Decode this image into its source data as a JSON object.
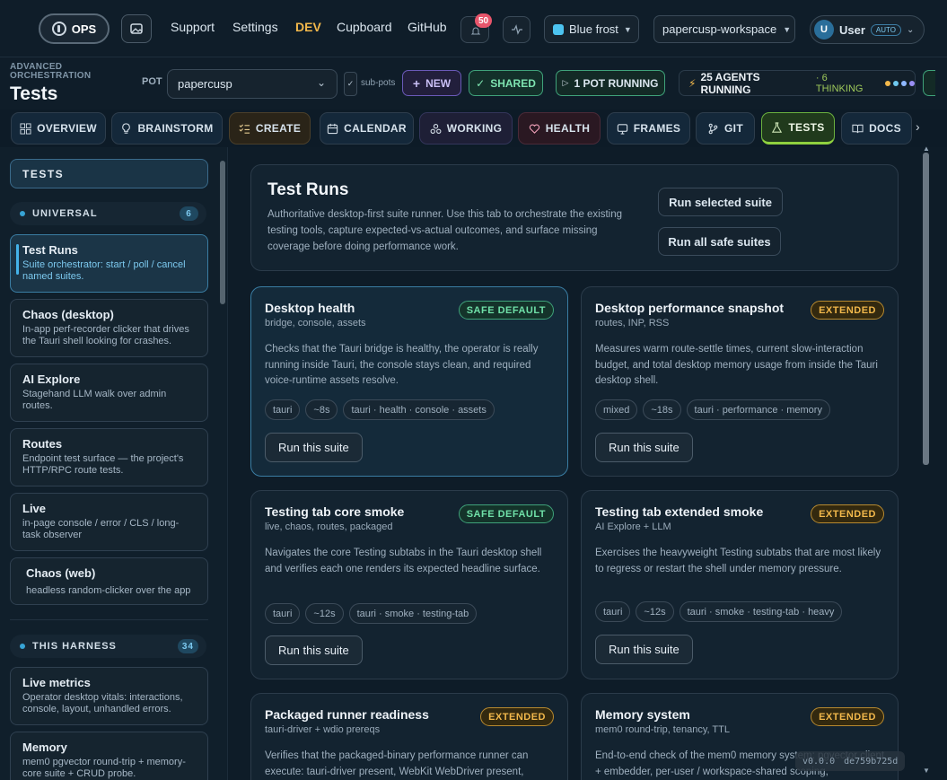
{
  "topbar": {
    "ops_label": "OPS",
    "nav": [
      "Support",
      "Settings",
      "DEV",
      "Cupboard",
      "GitHub"
    ],
    "notification_count": "50",
    "theme_label": "Blue frost",
    "theme_color": "#4cc3f0",
    "workspace_label": "papercusp-workspace",
    "user_initial": "U",
    "user_label": "User",
    "user_badge": "AUTO"
  },
  "header": {
    "eyebrow_line1": "ADVANCED",
    "eyebrow_line2": "ORCHESTRATION",
    "title": "Tests",
    "pot_label": "POT",
    "pot_value": "papercusp",
    "subpots_label": "sub-pots",
    "new_label": "NEW",
    "shared_label": "SHARED",
    "running_label": "1 POT RUNNING",
    "agents_label": "25 AGENTS RUNNING",
    "thinking_label": "· 6 THINKING"
  },
  "tabs": [
    "OVERVIEW",
    "BRAINSTORM",
    "CREATE",
    "CALENDAR",
    "WORKING",
    "HEALTH",
    "FRAMES",
    "GIT",
    "TESTS",
    "DOCS"
  ],
  "sidebar": {
    "title": "TESTS",
    "section1": {
      "label": "UNIVERSAL",
      "count": "6"
    },
    "section2": {
      "label": "THIS HARNESS",
      "count": "34"
    },
    "items": [
      {
        "title": "Test Runs",
        "sub": "Suite orchestrator: start / poll / cancel named suites."
      },
      {
        "title": "Chaos (desktop)",
        "sub": "In-app perf-recorder clicker that drives the Tauri shell looking for crashes."
      },
      {
        "title": "AI Explore",
        "sub": "Stagehand LLM walk over admin routes."
      },
      {
        "title": "Routes",
        "sub": "Endpoint test surface — the project's HTTP/RPC route tests."
      },
      {
        "title": "Live",
        "sub": "in-page console / error / CLS / long-task observer"
      },
      {
        "title": "Chaos (web)",
        "sub": "headless random-clicker over the app"
      }
    ],
    "harness_items": [
      {
        "title": "Live metrics",
        "sub": "Operator desktop vitals: interactions, console, layout, unhandled errors."
      },
      {
        "title": "Memory",
        "sub": "mem0 pgvector round-trip + memory-core suite + CRUD probe."
      }
    ]
  },
  "main": {
    "title": "Test Runs",
    "description": "Authoritative desktop-first suite runner. Use this tab to orchestrate the existing testing tools, capture expected-vs-actual outcomes, and surface missing coverage before doing performance work.",
    "run_selected": "Run selected suite",
    "run_all": "Run all safe suites",
    "run_suite_label": "Run this suite",
    "suites": [
      {
        "title": "Desktop health",
        "sub": "bridge, console, assets",
        "badge": "SAFE DEFAULT",
        "desc": "Checks that the Tauri bridge is healthy, the operator is really running inside Tauri, the console stays clean, and required voice-runtime assets resolve.",
        "chips": [
          "tauri",
          "~8s",
          "tauri · health · console · assets"
        ]
      },
      {
        "title": "Desktop performance snapshot",
        "sub": "routes, INP, RSS",
        "badge": "EXTENDED",
        "desc": "Measures warm route-settle times, current slow-interaction budget, and total desktop memory usage from inside the Tauri desktop shell.",
        "chips": [
          "mixed",
          "~18s",
          "tauri · performance · memory"
        ]
      },
      {
        "title": "Testing tab core smoke",
        "sub": "live, chaos, routes, packaged",
        "badge": "SAFE DEFAULT",
        "desc": "Navigates the core Testing subtabs in the Tauri desktop shell and verifies each one renders its expected headline surface.",
        "chips": [
          "tauri",
          "~12s",
          "tauri · smoke · testing-tab"
        ]
      },
      {
        "title": "Testing tab extended smoke",
        "sub": "AI Explore + LLM",
        "badge": "EXTENDED",
        "desc": "Exercises the heavyweight Testing subtabs that are most likely to regress or restart the shell under memory pressure.",
        "chips": [
          "tauri",
          "~12s",
          "tauri · smoke · testing-tab · heavy"
        ]
      },
      {
        "title": "Packaged runner readiness",
        "sub": "tauri-driver + wdio prereqs",
        "badge": "EXTENDED",
        "desc": "Verifies that the packaged-binary performance runner can execute: tauri-driver present, WebKit WebDriver present,",
        "chips": []
      },
      {
        "title": "Memory system",
        "sub": "mem0 round-trip, tenancy, TTL",
        "badge": "EXTENDED",
        "desc": "End-to-end check of the mem0 memory system: pgvector client + embedder, per-user / workspace-shared scoping,",
        "chips": []
      }
    ]
  },
  "footer": {
    "version": "v0.0.0",
    "hash": "de759b725d"
  }
}
